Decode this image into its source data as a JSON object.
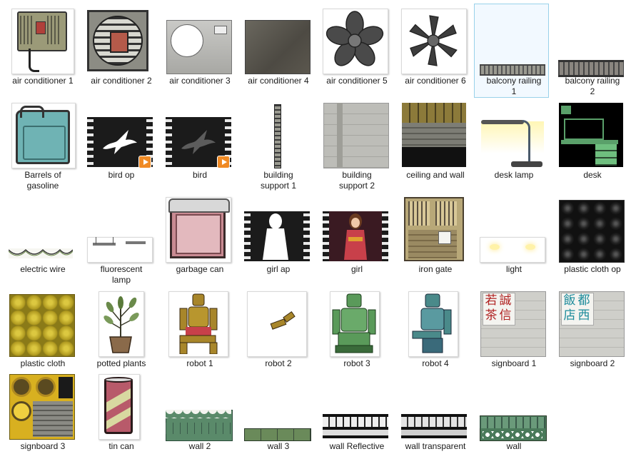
{
  "window_title": "",
  "items": [
    {
      "label": "air conditioner 1",
      "icon": "air-conditioner-icon"
    },
    {
      "label": "air conditioner 2",
      "icon": "vent-grill-icon"
    },
    {
      "label": "air conditioner 3",
      "icon": "metal-panel-icon"
    },
    {
      "label": "air conditioner 4",
      "icon": "rusted-plate-icon"
    },
    {
      "label": "air conditioner 5",
      "icon": "fan-blade-icon"
    },
    {
      "label": "air conditioner 6",
      "icon": "fan-blade-icon"
    },
    {
      "label": "balcony railing\n1",
      "icon": "railing-icon",
      "selected": true
    },
    {
      "label": "balcony railing\n2",
      "icon": "railing-icon"
    },
    {
      "label": "Barrels of\ngasoline",
      "icon": "gas-can-icon"
    },
    {
      "label": "bird op",
      "icon": "bird-video-icon"
    },
    {
      "label": "bird",
      "icon": "bird-video-icon"
    },
    {
      "label": "building\nsupport 1",
      "icon": "support-beam-icon"
    },
    {
      "label": "building\nsupport 2",
      "icon": "concrete-wall-icon"
    },
    {
      "label": "ceiling and wall",
      "icon": "ceiling-icon"
    },
    {
      "label": "desk lamp",
      "icon": "desk-lamp-icon"
    },
    {
      "label": "desk",
      "icon": "desk-icon"
    },
    {
      "label": "electric wire",
      "icon": "wire-icon"
    },
    {
      "label": "fluorescent\nlamp",
      "icon": "lamp-icon"
    },
    {
      "label": "garbage can",
      "icon": "garbage-can-icon"
    },
    {
      "label": "girl ap",
      "icon": "girl-video-icon"
    },
    {
      "label": "girl",
      "icon": "girl-video-icon"
    },
    {
      "label": "iron gate",
      "icon": "gate-icon"
    },
    {
      "label": "light",
      "icon": "light-icon"
    },
    {
      "label": "plastic cloth op",
      "icon": "tile-icon"
    },
    {
      "label": "plastic cloth",
      "icon": "tile-icon"
    },
    {
      "label": "potted plants",
      "icon": "plant-icon"
    },
    {
      "label": "robot 1",
      "icon": "robot-icon"
    },
    {
      "label": "robot 2",
      "icon": "robot-arm-icon"
    },
    {
      "label": "robot 3",
      "icon": "robot-icon"
    },
    {
      "label": "robot 4",
      "icon": "robot-icon"
    },
    {
      "label": "signboard 1",
      "icon": "signboard-icon",
      "chars": [
        "若",
        "誠",
        "茶",
        "信"
      ]
    },
    {
      "label": "signboard 2",
      "icon": "signboard-icon",
      "chars": [
        "飯",
        "都",
        "店",
        "西"
      ]
    },
    {
      "label": "signboard 3",
      "icon": "signboard-icon"
    },
    {
      "label": "tin can",
      "icon": "tin-can-icon"
    },
    {
      "label": "wall 2",
      "icon": "wall-strip-icon"
    },
    {
      "label": "wall 3",
      "icon": "wall-strip-icon"
    },
    {
      "label": "wall Reflective",
      "icon": "wall-strip-icon"
    },
    {
      "label": "wall transparent",
      "icon": "wall-strip-icon"
    },
    {
      "label": "wall",
      "icon": "wall-strip-icon"
    }
  ]
}
